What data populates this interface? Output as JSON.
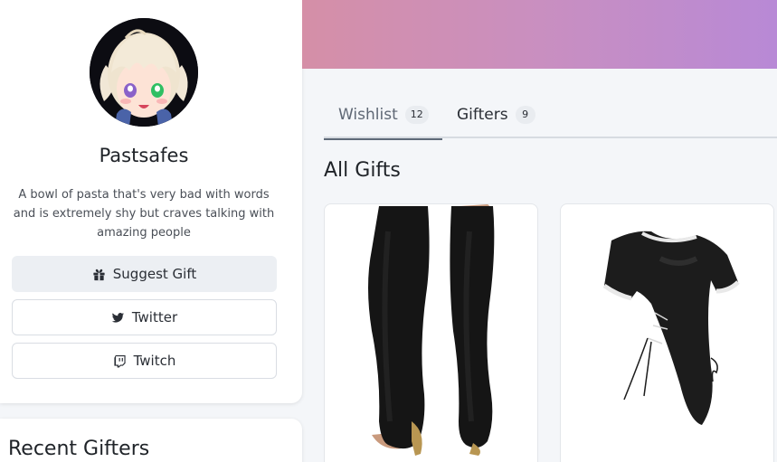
{
  "profile": {
    "name": "Pastsafes",
    "bio": "A bowl of pasta that's very bad with words and is extremely shy but craves talking with amazing people",
    "avatar_icon": "anime-avatar",
    "buttons": {
      "suggest": "Suggest Gift",
      "twitter": "Twitter",
      "twitch": "Twitch"
    }
  },
  "recent_gifters": {
    "title": "Recent Gifters"
  },
  "banner": {
    "colors": [
      "#d58fa7",
      "#b889d6"
    ]
  },
  "tabs": [
    {
      "label": "Wishlist",
      "count": "12",
      "active": true
    },
    {
      "label": "Gifters",
      "count": "9",
      "active": false
    }
  ],
  "gifts": {
    "title": "All Gifts",
    "items": [
      {
        "image": "black-thigh-high-stockings"
      },
      {
        "image": "black-lace-up-top"
      }
    ]
  }
}
